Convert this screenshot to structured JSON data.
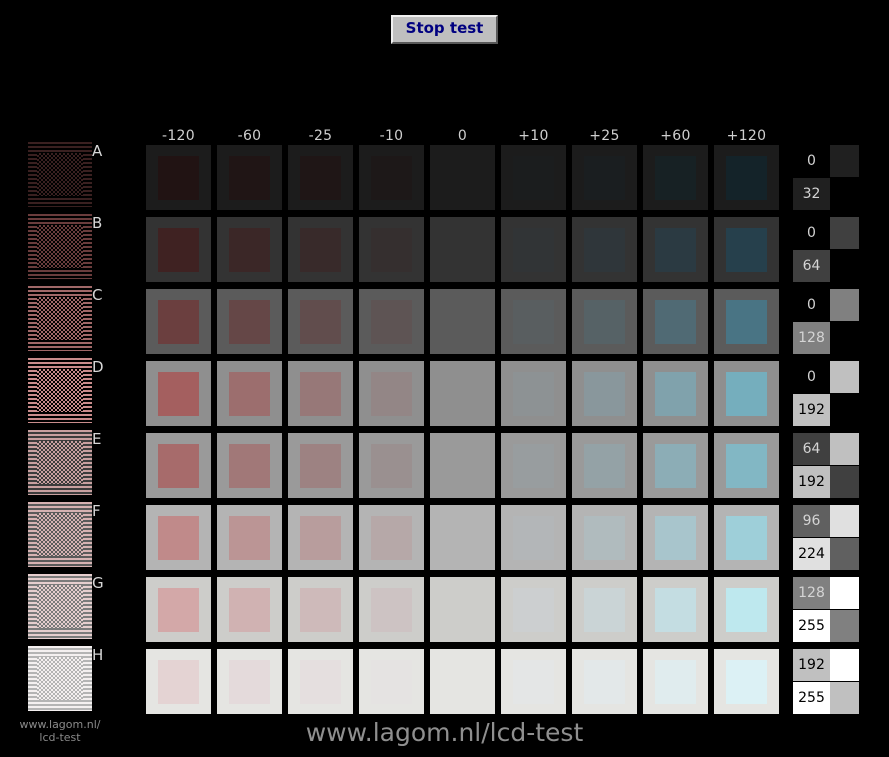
{
  "page": {
    "background": "#000000",
    "watermark_main": "www.lagom.nl/lcd-test",
    "watermark_small_line1": "www.lagom.nl/",
    "watermark_small_line2": "lcd-test"
  },
  "toolbar": {
    "stop_test_label": "Stop test",
    "stop_test_text_color": "#000080",
    "stop_test_face_color": "#bfbfbf"
  },
  "grid": {
    "column_headers": [
      "-120",
      "-60",
      "-25",
      "-10",
      "0",
      "+10",
      "+25",
      "+60",
      "+120"
    ],
    "column_offsets": [
      -120,
      -60,
      -25,
      -10,
      0,
      10,
      25,
      60,
      120
    ],
    "row_letters": [
      "A",
      "B",
      "C",
      "D",
      "E",
      "F",
      "G",
      "H"
    ],
    "rows": [
      {
        "letter": "A",
        "low_value": 0,
        "high_value": 32,
        "outer": "#1c1c1c",
        "inner": [
          "#211313",
          "#201515",
          "#1f1616",
          "#1d1818",
          "#1c1c1c",
          "#1b1d1e",
          "#1a1e20",
          "#172124",
          "#142329"
        ],
        "ref_dark": "#000000",
        "ref_light": "#3a2020"
      },
      {
        "letter": "B",
        "low_value": 0,
        "high_value": 64,
        "outer": "#333333",
        "inner": [
          "#3f2222",
          "#3b2727",
          "#382a2a",
          "#352f2f",
          "#333333",
          "#313436",
          "#2f363a",
          "#2b3a42",
          "#26404c"
        ],
        "ref_dark": "#000000",
        "ref_light": "#6a3c3c"
      },
      {
        "letter": "C",
        "low_value": 0,
        "high_value": 128,
        "outer": "#5b5b5b",
        "inner": [
          "#6b3f3f",
          "#654747",
          "#614d4d",
          "#5e5454",
          "#5b5b5b",
          "#595e60",
          "#566266",
          "#506a74",
          "#497484"
        ],
        "ref_dark": "#000000",
        "ref_light": "#a06868"
      },
      {
        "letter": "D",
        "low_value": 0,
        "high_value": 192,
        "outer": "#8f8f8f",
        "inner": [
          "#a45f5f",
          "#9c6e6e",
          "#977878",
          "#938686",
          "#8f8f8f",
          "#8d9294",
          "#89979c",
          "#80a2ac",
          "#75aebd"
        ],
        "ref_dark": "#000000",
        "ref_light": "#c98c8c"
      },
      {
        "letter": "E",
        "low_value": 64,
        "high_value": 192,
        "outer": "#9a9a9a",
        "inner": [
          "#a76b6b",
          "#a17878",
          "#9d8282",
          "#9a9090",
          "#9a9a9a",
          "#989d9f",
          "#94a2a6",
          "#8cadb6",
          "#82b7c4"
        ],
        "ref_dark": "#3c3c3c",
        "ref_light": "#c9a0a0"
      },
      {
        "letter": "F",
        "low_value": 96,
        "high_value": 224,
        "outer": "#b4b4b4",
        "inner": [
          "#c08a8a",
          "#bb9595",
          "#b89d9d",
          "#b6a8a8",
          "#b4b4b4",
          "#b3b6b8",
          "#b0bbbe",
          "#a8c5cc",
          "#9ecfd9"
        ],
        "ref_dark": "#5a5a5a",
        "ref_light": "#d6b2b2"
      },
      {
        "letter": "G",
        "low_value": 128,
        "high_value": 255,
        "outer": "#cdcdca",
        "inner": [
          "#d3a8a8",
          "#d0b2b2",
          "#cebaba",
          "#cdc3c3",
          "#cdcdca",
          "#cccfd0",
          "#cad4d6",
          "#c4dde2",
          "#bee8ee"
        ],
        "ref_dark": "#7b7b7b",
        "ref_light": "#e6cece"
      },
      {
        "letter": "H",
        "low_value": 192,
        "high_value": 255,
        "outer": "#e5e5e2",
        "inner": [
          "#e4d3d3",
          "#e4dadb",
          "#e5dfdf",
          "#e5e3e2",
          "#e5e5e2",
          "#e4e6e6",
          "#e3e8e9",
          "#e0ecee",
          "#dcf1f5"
        ],
        "ref_dark": "#b4b4b4",
        "ref_light": "#f4f0f0"
      }
    ]
  }
}
